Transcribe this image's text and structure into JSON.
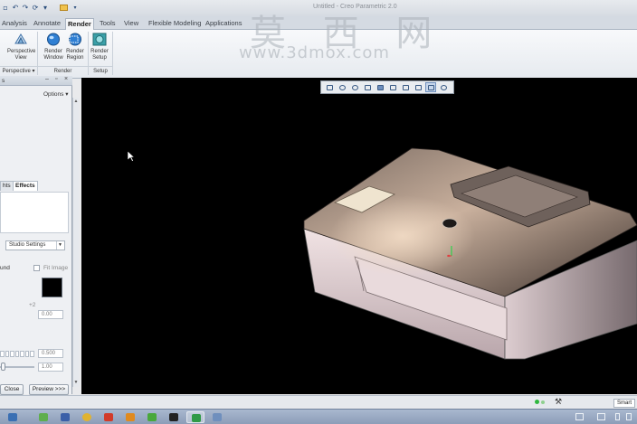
{
  "window": {
    "title": "Untitled - Creo Parametric 2.0"
  },
  "quick_access": {
    "icons": [
      "new-file-icon",
      "undo-icon",
      "redo-icon",
      "regenerate-icon",
      "open-folder-icon",
      "customize-arrow-icon"
    ]
  },
  "watermark": {
    "chars": "莫 西 网",
    "url": "www.3dmox.com"
  },
  "ribbon": {
    "tabs": [
      "Analysis",
      "Annotate",
      "Render",
      "Tools",
      "View",
      "Flexible Modeling",
      "Applications"
    ],
    "active_tab": "Render",
    "buttons": [
      {
        "line1": "Perspective",
        "line2": "View"
      },
      {
        "line1": "Render",
        "line2": "Window"
      },
      {
        "line1": "Render",
        "line2": "Region"
      },
      {
        "line1": "Render",
        "line2": "Setup"
      }
    ],
    "groups": [
      "Perspective",
      "Render",
      "Setup"
    ]
  },
  "panel": {
    "title": "s",
    "options_label": "Options",
    "tabs": [
      "hts",
      "Effects"
    ],
    "active_tab": "Effects",
    "dropdown_value": "Studio Settings",
    "fragment_und": "und",
    "fit_image_label": "Fit Image",
    "small_label": "+2",
    "value_1": "0.00",
    "value_2": "0.500",
    "value_3": "1.00",
    "close_label": "Close",
    "preview_label": "Preview >>>"
  },
  "viewport": {
    "background": "#000000",
    "toolbar_icons": [
      "refit-icon",
      "zoom-in-icon",
      "zoom-out-icon",
      "repaint-icon",
      "display-style-icon",
      "saved-orientations-icon",
      "view-manager-icon",
      "perspective-icon",
      "datum-display-icon",
      "spin-center-icon"
    ],
    "toolbar_selected": "datum-display-icon"
  },
  "statusbar": {
    "selection_filter": "Smart"
  },
  "taskbar": {
    "apps": [
      {
        "icon": "start-icon",
        "color": "#3a6fb3"
      },
      {
        "icon": "explorer-icon",
        "color": "#5fae4e"
      },
      {
        "icon": "media-icon",
        "color": "#3b5fa8"
      },
      {
        "icon": "chrome-icon",
        "color": "#e0b331"
      },
      {
        "icon": "app-red-icon",
        "color": "#d23b2a"
      },
      {
        "icon": "app-orange-icon",
        "color": "#e08a1f"
      },
      {
        "icon": "app-green-icon",
        "color": "#49a83b"
      },
      {
        "icon": "app-yellow-icon",
        "color": "#d8b42a"
      },
      {
        "icon": "terminal-icon",
        "color": "#222222"
      },
      {
        "icon": "creo-icon",
        "color": "#2f9a46"
      },
      {
        "icon": "window-icon",
        "color": "#6f8fbd"
      }
    ],
    "active_index": 9
  },
  "colors": {
    "accent": "#2a4d7c",
    "viewport_bg": "#000000",
    "status_green": "#2fb83f"
  }
}
